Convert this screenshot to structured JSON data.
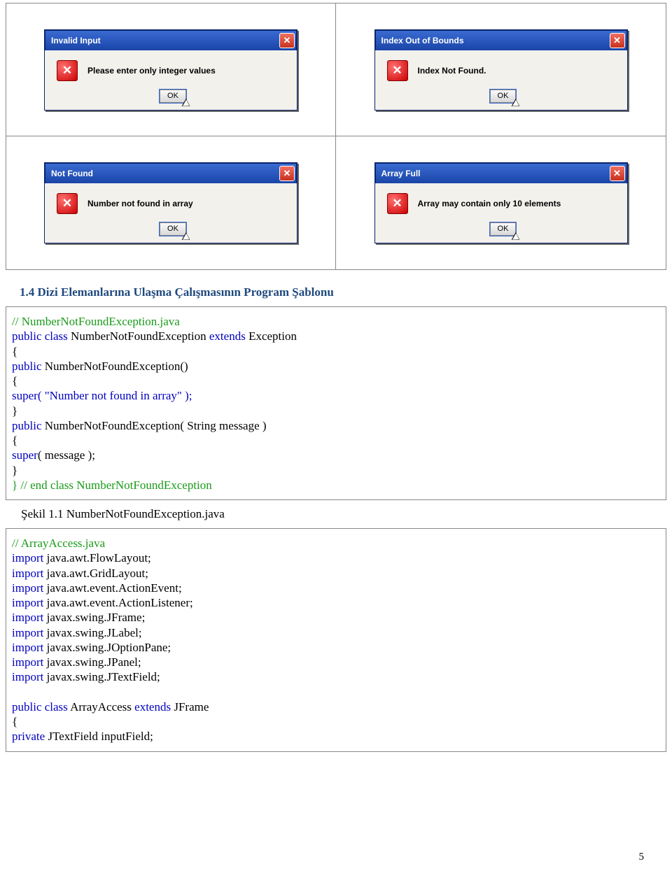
{
  "dialogs": [
    {
      "title": "Invalid Input",
      "message": "Please enter only integer values",
      "button": "OK"
    },
    {
      "title": "Index Out of Bounds",
      "message": "Index Not Found.",
      "button": "OK"
    },
    {
      "title": "Not Found",
      "message": "Number not found in array",
      "button": "OK"
    },
    {
      "title": "Array Full",
      "message": "Array may contain only 10 elements",
      "button": "OK"
    }
  ],
  "section_heading": "1.4  Dizi Elemanlarına Ulaşma Çalışmasının Program Şablonu",
  "code_block_1": {
    "l1": "// NumberNotFoundException.java",
    "l2a": " public class",
    "l2b": " NumberNotFoundException ",
    "l2c": "extends",
    "l2d": " Exception",
    "l3a": "public",
    "l3b": " NumberNotFoundException()",
    "l4a": "super",
    "l4b": "( \"Number not found in array\" );",
    "l5a": "public",
    "l5b": " NumberNotFoundException( String message )",
    "l6a": "super",
    "l6b": "( message );",
    "l7": "} // end class NumberNotFoundException"
  },
  "caption_1": "Şekil 1.1 NumberNotFoundException.java",
  "code_block_2": {
    "l1": "// ArrayAccess.java",
    "l2a": " import",
    "l2b": " java.awt.FlowLayout;",
    "l3a": " import",
    "l3b": " java.awt.GridLayout;",
    "l4a": " import",
    "l4b": " java.awt.event.ActionEvent;",
    "l5a": " import",
    "l5b": " java.awt.event.ActionListener;",
    "l6a": " import",
    "l6b": " javax.swing.JFrame;",
    "l7a": " import",
    "l7b": " javax.swing.JLabel;",
    "l8a": " import",
    "l8b": " javax.swing.JOptionPane;",
    "l9a": " import",
    "l9b": " javax.swing.JPanel;",
    "l10a": " import",
    "l10b": " javax.swing.JTextField;",
    "l11a": " public class",
    "l11b": " ArrayAccess ",
    "l11c": "extends",
    "l11d": " JFrame",
    "l12a": " private",
    "l12b": " JTextField inputField;"
  },
  "page_number": "5"
}
